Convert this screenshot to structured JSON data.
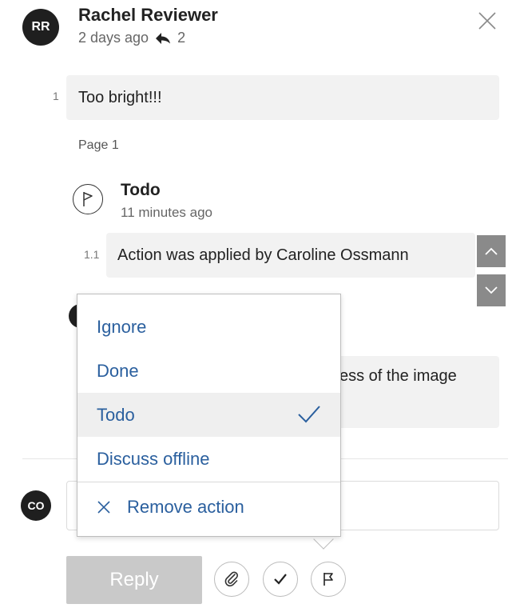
{
  "comment": {
    "avatar_initials": "RR",
    "author": "Rachel Reviewer",
    "time": "2 days ago",
    "reply_count": "2",
    "number": "1",
    "text": "Too bright!!!",
    "page_label": "Page 1"
  },
  "action_reply": {
    "status": "Todo",
    "time": "11 minutes ago",
    "number": "1.1",
    "text": "Action was applied by Caroline Ossmann"
  },
  "partial_reply": {
    "text_fragment": "ess of the image"
  },
  "composer": {
    "avatar_initials": "CO",
    "reply_label": "Reply"
  },
  "action_menu": {
    "items": [
      {
        "label": "Ignore",
        "selected": false
      },
      {
        "label": "Done",
        "selected": false
      },
      {
        "label": "Todo",
        "selected": true
      },
      {
        "label": "Discuss offline",
        "selected": false
      }
    ],
    "remove_label": "Remove action"
  },
  "icons": {
    "close": "close-icon",
    "reply": "reply-arrow-icon",
    "flag": "flag-icon",
    "attach": "paperclip-icon",
    "check": "check-icon",
    "up": "chevron-up-icon",
    "down": "chevron-down-icon"
  },
  "colors": {
    "menu_text": "#2a5f9e",
    "avatar_bg": "#1f1f1f",
    "bubble_bg": "#f2f2f2",
    "reply_button_bg": "#c9c9c9"
  }
}
